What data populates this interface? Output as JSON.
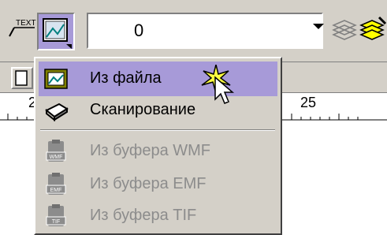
{
  "toolbar": {
    "text_button_label": "TEXT",
    "layer_value": "0",
    "icons": [
      "text-icon",
      "insert-picture-icon",
      "layers-icon",
      "layer-properties-icon",
      "layer-edit-icon"
    ]
  },
  "ruler": {
    "labels": [
      "2",
      "25"
    ]
  },
  "menu": {
    "items": [
      {
        "label": "Из файла",
        "icon": "file-folder-icon",
        "enabled": true,
        "highlighted": true
      },
      {
        "label": "Сканирование",
        "icon": "scanner-icon",
        "enabled": true,
        "highlighted": false
      },
      {
        "label": "Из буфера WMF",
        "icon": "clipboard-wmf-icon",
        "enabled": false,
        "badge": "WMF"
      },
      {
        "label": "Из буфера EMF",
        "icon": "clipboard-emf-icon",
        "enabled": false,
        "badge": "EMF"
      },
      {
        "label": "Из буфера TIF",
        "icon": "clipboard-tif-icon",
        "enabled": false,
        "badge": "TIF"
      }
    ]
  },
  "colors": {
    "highlight": "#a79ad8",
    "face": "#d4d0c8",
    "disabled": "#8c8c8c"
  }
}
